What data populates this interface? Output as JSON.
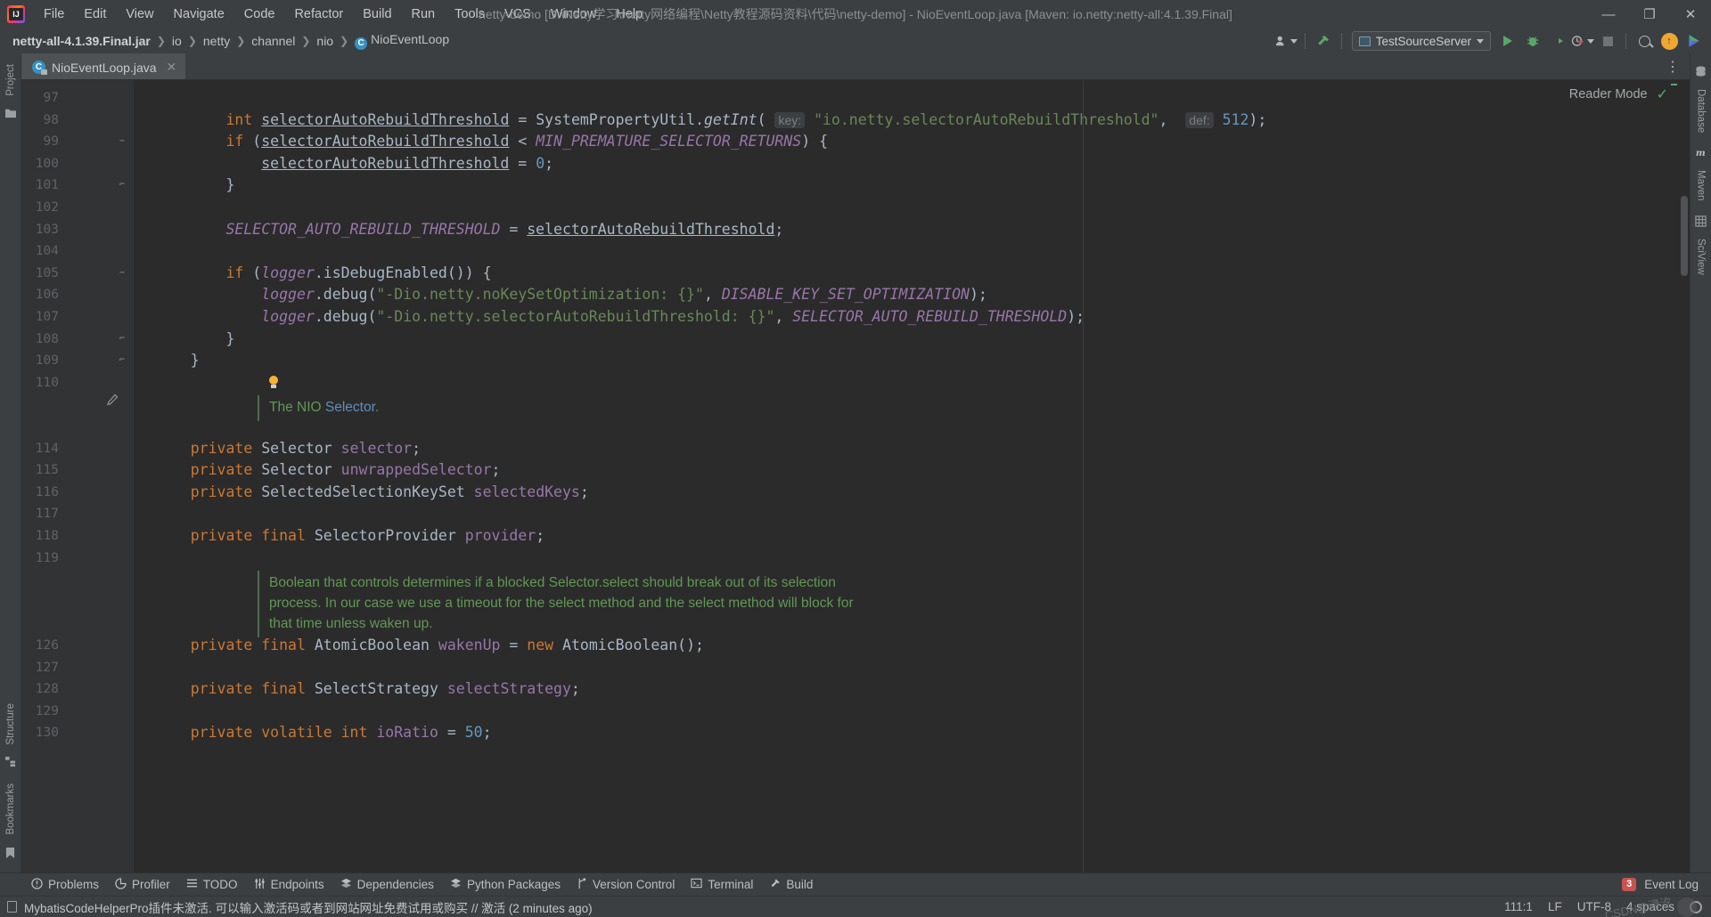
{
  "window": {
    "title": "netty-demo [D:\\Netty学习\\Netty网络编程\\Netty教程源码资料\\代码\\netty-demo] - NioEventLoop.java [Maven: io.netty:netty-all:4.1.39.Final]",
    "logo": "intellij-idea-logo",
    "minimize": "—",
    "maximize": "❐",
    "close": "✕"
  },
  "menubar": {
    "items": [
      {
        "label": "File"
      },
      {
        "label": "Edit"
      },
      {
        "label": "View"
      },
      {
        "label": "Navigate"
      },
      {
        "label": "Code"
      },
      {
        "label": "Refactor"
      },
      {
        "label": "Build"
      },
      {
        "label": "Run"
      },
      {
        "label": "Tools"
      },
      {
        "label": "VCS"
      },
      {
        "label": "Window"
      },
      {
        "label": "Help"
      }
    ]
  },
  "breadcrumb": {
    "items": [
      {
        "label": "netty-all-4.1.39.Final.jar",
        "bold": true
      },
      {
        "label": "io",
        "bold": false
      },
      {
        "label": "netty",
        "bold": false
      },
      {
        "label": "channel",
        "bold": false
      },
      {
        "label": "nio",
        "bold": false
      },
      {
        "label": "NioEventLoop",
        "bold": false,
        "icon": "class-icon"
      }
    ],
    "separator": "❯"
  },
  "toolbar": {
    "run_configuration": "TestSourceServer",
    "buttons": [
      {
        "name": "user-icon",
        "glyph": "👤"
      },
      {
        "name": "hammer-build-icon",
        "glyph": "🔨"
      },
      {
        "name": "run-icon",
        "glyph": "▶"
      },
      {
        "name": "debug-icon",
        "glyph": "🐞"
      },
      {
        "name": "run-coverage-icon",
        "glyph": "◖"
      },
      {
        "name": "profiler-icon",
        "glyph": "◷"
      },
      {
        "name": "stop-icon",
        "glyph": "■"
      },
      {
        "name": "search-everywhere-icon",
        "glyph": "🔍"
      },
      {
        "name": "update-project-icon",
        "glyph": "↑"
      },
      {
        "name": "ide-feature-icon",
        "glyph": "▶"
      }
    ]
  },
  "left_rail": {
    "items": [
      {
        "label": "Project",
        "icon": "project-icon"
      },
      {
        "label": "Structure",
        "icon": "structure-icon"
      },
      {
        "label": "Bookmarks",
        "icon": "bookmarks-icon"
      }
    ]
  },
  "right_rail": {
    "items": [
      {
        "label": "Database",
        "icon": "database-icon"
      },
      {
        "label": "Maven",
        "icon": "maven-icon"
      },
      {
        "label": "SciView",
        "icon": "sciview-icon"
      }
    ]
  },
  "editor": {
    "tab": {
      "label": "NioEventLoop.java",
      "icon": "java-class-file-icon",
      "close": "✕"
    },
    "more_actions": "⋮",
    "reader_mode": "Reader Mode",
    "reader_check": "✓",
    "lines": [
      {
        "n": "97",
        "y": 0,
        "fold": "",
        "segs": []
      },
      {
        "n": "98",
        "y": 1,
        "fold": "",
        "segs": [
          {
            "t": "        ",
            "c": "pl"
          },
          {
            "t": "int ",
            "c": "kw"
          },
          {
            "t": "selectorAutoRebuildThreshold",
            "c": "lvar"
          },
          {
            "t": " = ",
            "c": "pl"
          },
          {
            "t": "SystemPropertyUtil",
            "c": "pl"
          },
          {
            "t": ".",
            "c": "pl"
          },
          {
            "t": "getInt",
            "c": "mtd"
          },
          {
            "t": "( ",
            "c": "pl"
          },
          {
            "t": "key:",
            "c": "hint"
          },
          {
            "t": " ",
            "c": "pl"
          },
          {
            "t": "\"io.netty.selectorAutoRebuildThreshold\"",
            "c": "str"
          },
          {
            "t": ",  ",
            "c": "pl"
          },
          {
            "t": "def:",
            "c": "hint"
          },
          {
            "t": " ",
            "c": "pl"
          },
          {
            "t": "512",
            "c": "num"
          },
          {
            "t": ");",
            "c": "pl"
          }
        ]
      },
      {
        "n": "99",
        "y": 2,
        "fold": "−",
        "segs": [
          {
            "t": "        ",
            "c": "pl"
          },
          {
            "t": "if ",
            "c": "kw"
          },
          {
            "t": "(",
            "c": "pl"
          },
          {
            "t": "selectorAutoRebuildThreshold",
            "c": "lvar"
          },
          {
            "t": " < ",
            "c": "pl"
          },
          {
            "t": "MIN_PREMATURE_SELECTOR_RETURNS",
            "c": "stat"
          },
          {
            "t": ") {",
            "c": "pl"
          }
        ]
      },
      {
        "n": "100",
        "y": 3,
        "fold": "",
        "segs": [
          {
            "t": "            ",
            "c": "pl"
          },
          {
            "t": "selectorAutoRebuildThreshold",
            "c": "lvar"
          },
          {
            "t": " = ",
            "c": "pl"
          },
          {
            "t": "0",
            "c": "num"
          },
          {
            "t": ";",
            "c": "pl"
          }
        ]
      },
      {
        "n": "101",
        "y": 4,
        "fold": "⌐",
        "segs": [
          {
            "t": "        }",
            "c": "pl"
          }
        ]
      },
      {
        "n": "102",
        "y": 5,
        "fold": "",
        "segs": []
      },
      {
        "n": "103",
        "y": 6,
        "fold": "",
        "segs": [
          {
            "t": "        ",
            "c": "pl"
          },
          {
            "t": "SELECTOR_AUTO_REBUILD_THRESHOLD",
            "c": "stat"
          },
          {
            "t": " = ",
            "c": "pl"
          },
          {
            "t": "selectorAutoRebuildThreshold",
            "c": "lvar"
          },
          {
            "t": ";",
            "c": "pl"
          }
        ]
      },
      {
        "n": "104",
        "y": 7,
        "fold": "",
        "segs": []
      },
      {
        "n": "105",
        "y": 8,
        "fold": "−",
        "segs": [
          {
            "t": "        ",
            "c": "pl"
          },
          {
            "t": "if ",
            "c": "kw"
          },
          {
            "t": "(",
            "c": "pl"
          },
          {
            "t": "logger",
            "c": "stat"
          },
          {
            "t": ".",
            "c": "pl"
          },
          {
            "t": "isDebugEnabled",
            "c": "pl"
          },
          {
            "t": "()) {",
            "c": "pl"
          }
        ]
      },
      {
        "n": "106",
        "y": 9,
        "fold": "",
        "segs": [
          {
            "t": "            ",
            "c": "pl"
          },
          {
            "t": "logger",
            "c": "stat"
          },
          {
            "t": ".",
            "c": "pl"
          },
          {
            "t": "debug",
            "c": "pl"
          },
          {
            "t": "(",
            "c": "pl"
          },
          {
            "t": "\"-Dio.netty.noKeySetOptimization: {}\"",
            "c": "str"
          },
          {
            "t": ", ",
            "c": "pl"
          },
          {
            "t": "DISABLE_KEY_SET_OPTIMIZATION",
            "c": "stat"
          },
          {
            "t": ");",
            "c": "pl"
          }
        ]
      },
      {
        "n": "107",
        "y": 10,
        "fold": "",
        "segs": [
          {
            "t": "            ",
            "c": "pl"
          },
          {
            "t": "logger",
            "c": "stat"
          },
          {
            "t": ".",
            "c": "pl"
          },
          {
            "t": "debug",
            "c": "pl"
          },
          {
            "t": "(",
            "c": "pl"
          },
          {
            "t": "\"-Dio.netty.selectorAutoRebuildThreshold: {}\"",
            "c": "str"
          },
          {
            "t": ", ",
            "c": "pl"
          },
          {
            "t": "SELECTOR_AUTO_REBUILD_THRESHOLD",
            "c": "stat"
          },
          {
            "t": ");",
            "c": "pl"
          }
        ]
      },
      {
        "n": "108",
        "y": 11,
        "fold": "⌐",
        "segs": [
          {
            "t": "        }",
            "c": "pl"
          }
        ]
      },
      {
        "n": "109",
        "y": 12,
        "fold": "⌐",
        "segs": [
          {
            "t": "    }",
            "c": "pl"
          }
        ]
      },
      {
        "n": "110",
        "y": 13,
        "fold": "",
        "segs": [],
        "bulb": true
      },
      {
        "n": "114",
        "y": 16,
        "fold": "",
        "segs": [
          {
            "t": "    ",
            "c": "pl"
          },
          {
            "t": "private ",
            "c": "kw"
          },
          {
            "t": "Selector ",
            "c": "pl"
          },
          {
            "t": "selector",
            "c": "fld"
          },
          {
            "t": ";",
            "c": "pl"
          }
        ]
      },
      {
        "n": "115",
        "y": 17,
        "fold": "",
        "segs": [
          {
            "t": "    ",
            "c": "pl"
          },
          {
            "t": "private ",
            "c": "kw"
          },
          {
            "t": "Selector ",
            "c": "pl"
          },
          {
            "t": "unwrappedSelector",
            "c": "fld"
          },
          {
            "t": ";",
            "c": "pl"
          }
        ]
      },
      {
        "n": "116",
        "y": 18,
        "fold": "",
        "segs": [
          {
            "t": "    ",
            "c": "pl"
          },
          {
            "t": "private ",
            "c": "kw"
          },
          {
            "t": "SelectedSelectionKeySet ",
            "c": "pl"
          },
          {
            "t": "selectedKeys",
            "c": "fld"
          },
          {
            "t": ";",
            "c": "pl"
          }
        ]
      },
      {
        "n": "117",
        "y": 19,
        "fold": "",
        "segs": []
      },
      {
        "n": "118",
        "y": 20,
        "fold": "",
        "segs": [
          {
            "t": "    ",
            "c": "pl"
          },
          {
            "t": "private final ",
            "c": "kw"
          },
          {
            "t": "SelectorProvider ",
            "c": "pl"
          },
          {
            "t": "provider",
            "c": "fld"
          },
          {
            "t": ";",
            "c": "pl"
          }
        ]
      },
      {
        "n": "119",
        "y": 21,
        "fold": "",
        "segs": []
      },
      {
        "n": "126",
        "y": 25,
        "fold": "",
        "segs": [
          {
            "t": "    ",
            "c": "pl"
          },
          {
            "t": "private final ",
            "c": "kw"
          },
          {
            "t": "AtomicBoolean ",
            "c": "pl"
          },
          {
            "t": "wakenUp",
            "c": "fld"
          },
          {
            "t": " = ",
            "c": "pl"
          },
          {
            "t": "new ",
            "c": "kw"
          },
          {
            "t": "AtomicBoolean();",
            "c": "pl"
          }
        ]
      },
      {
        "n": "127",
        "y": 26,
        "fold": "",
        "segs": []
      },
      {
        "n": "128",
        "y": 27,
        "fold": "",
        "segs": [
          {
            "t": "    ",
            "c": "pl"
          },
          {
            "t": "private final ",
            "c": "kw"
          },
          {
            "t": "SelectStrategy ",
            "c": "pl"
          },
          {
            "t": "selectStrategy",
            "c": "fld"
          },
          {
            "t": ";",
            "c": "pl"
          }
        ]
      },
      {
        "n": "129",
        "y": 28,
        "fold": "",
        "segs": []
      },
      {
        "n": "130",
        "y": 29,
        "fold": "",
        "segs": [
          {
            "t": "    ",
            "c": "pl"
          },
          {
            "t": "private volatile int ",
            "c": "kw"
          },
          {
            "t": "ioRatio",
            "c": "fld"
          },
          {
            "t": " = ",
            "c": "pl"
          },
          {
            "t": "50",
            "c": "num"
          },
          {
            "t": ";",
            "c": "pl"
          }
        ]
      }
    ],
    "docs": [
      {
        "y": 14,
        "lines": [
          [
            {
              "t": "The NIO ",
              "c": "doc"
            },
            {
              "t": "Selector",
              "c": "tag"
            },
            {
              "t": ".",
              "c": "doc"
            }
          ]
        ]
      },
      {
        "y": 22,
        "lines": [
          [
            {
              "t": "Boolean that controls determines if a blocked Selector.select should break out of its selection",
              "c": "doc"
            }
          ],
          [
            {
              "t": "process. In our case we use a timeout for the select method and the select method will block for",
              "c": "doc"
            }
          ],
          [
            {
              "t": "that time unless waken up.",
              "c": "doc"
            }
          ]
        ]
      }
    ]
  },
  "tool_windows": {
    "items": [
      {
        "label": "Problems",
        "icon": "problems-icon",
        "glyph": "❶"
      },
      {
        "label": "Profiler",
        "icon": "profiler-icon",
        "glyph": "◔"
      },
      {
        "label": "TODO",
        "icon": "todo-icon",
        "glyph": "☰"
      },
      {
        "label": "Endpoints",
        "icon": "endpoints-icon",
        "glyph": "⑃"
      },
      {
        "label": "Dependencies",
        "icon": "dependencies-icon",
        "glyph": "❂"
      },
      {
        "label": "Python Packages",
        "icon": "python-packages-icon",
        "glyph": "❂"
      },
      {
        "label": "Version Control",
        "icon": "version-control-icon",
        "glyph": "⑂"
      },
      {
        "label": "Terminal",
        "icon": "terminal-icon",
        "glyph": "▣"
      },
      {
        "label": "Build",
        "icon": "build-icon",
        "glyph": "🔨"
      }
    ],
    "event_log": {
      "label": "Event Log",
      "count": "3"
    }
  },
  "statusbar": {
    "message": "MybatisCodeHelperPro插件未激活. 可以输入激活码或者到网站网址免费试用或购买 // 激活 (2 minutes ago)",
    "caret": "111:1",
    "line_sep": "LF",
    "encoding": "UTF-8",
    "indent": "4 spaces",
    "watermark": "CSDN@浔汐"
  },
  "colors": {
    "accent_green": "#59a869",
    "string": "#6a8759",
    "keyword": "#cc7832",
    "number": "#6897bb",
    "field": "#9876aa",
    "doc": "#629755",
    "editor_bg": "#2b2b2b",
    "chrome_bg": "#3c3f41"
  }
}
